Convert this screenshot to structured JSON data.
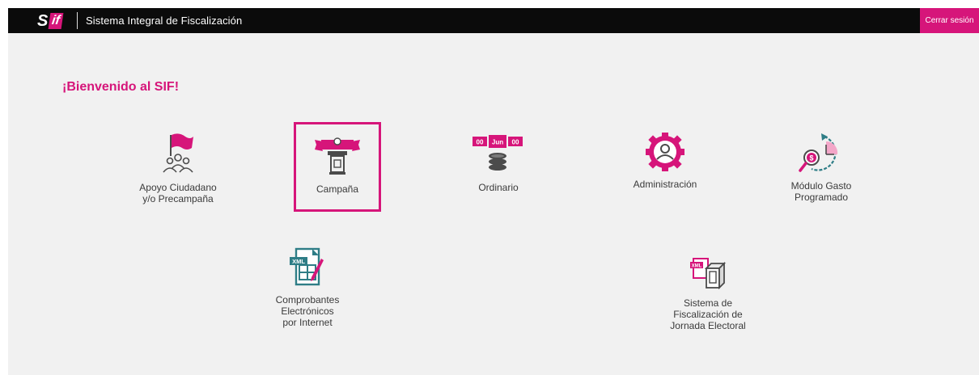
{
  "header": {
    "logo_s": "S",
    "logo_if": "if",
    "title": "Sistema Integral de Fiscalización",
    "logout_label": "Cerrar sesión"
  },
  "welcome": "¡Bienvenido al SIF!",
  "modules": [
    {
      "label": "Apoyo Ciudadano\ny/o Precampaña",
      "icon": "flag-people-icon",
      "selected": false
    },
    {
      "label": "Campaña",
      "icon": "podium-icon",
      "selected": true
    },
    {
      "label": "Ordinario",
      "icon": "calendar-coins-icon",
      "selected": false
    },
    {
      "label": "Administración",
      "icon": "user-gear-icon",
      "selected": false
    },
    {
      "label": "Módulo Gasto\nProgramado",
      "icon": "clock-money-icon",
      "selected": false
    },
    {
      "label": "Comprobantes\nElectrónicos\npor Internet",
      "icon": "xml-edit-icon",
      "selected": false
    },
    {
      "label": "Sistema de\nFiscalización de\nJornada Electoral",
      "icon": "xml-box-icon",
      "selected": false
    }
  ],
  "calendar_badge": {
    "left": "00",
    "middle": "Jun",
    "right": "00"
  },
  "xml_text": "XML",
  "colors": {
    "accent": "#d6157a",
    "icon_gray": "#4b4b4b",
    "teal": "#2e7d86",
    "background": "#f1f1f1",
    "topbar": "#0b0b0b"
  }
}
